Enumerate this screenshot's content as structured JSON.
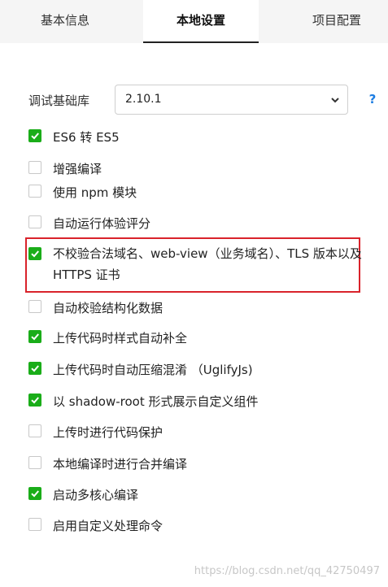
{
  "tabs": [
    {
      "label": "基本信息"
    },
    {
      "label": "本地设置"
    },
    {
      "label": "项目配置"
    }
  ],
  "lib": {
    "label": "调试基础库",
    "value": "2.10.1",
    "help": "?"
  },
  "options": [
    {
      "label": "ES6 转 ES5",
      "checked": true
    },
    {
      "label": "增强编译",
      "checked": false
    },
    {
      "label": "使用 npm 模块",
      "checked": false
    },
    {
      "label": "自动运行体验评分",
      "checked": false
    },
    {
      "label": "不校验合法域名、web-view（业务域名）、TLS 版本以及 HTTPS 证书",
      "checked": true
    },
    {
      "label": "自动校验结构化数据",
      "checked": false
    },
    {
      "label": "上传代码时样式自动补全",
      "checked": true
    },
    {
      "label": "上传代码时自动压缩混淆 （UglifyJs)",
      "checked": true
    },
    {
      "label": "以 shadow-root 形式展示自定义组件",
      "checked": true
    },
    {
      "label": "上传时进行代码保护",
      "checked": false
    },
    {
      "label": "本地编译时进行合并编译",
      "checked": false
    },
    {
      "label": "启动多核心编译",
      "checked": true
    },
    {
      "label": "启用自定义处理命令",
      "checked": false
    }
  ],
  "watermark": "https://blog.csdn.net/qq_42750497",
  "colors": {
    "check": "#1aad19",
    "highlight": "#d9232b",
    "help": "#1c7de2"
  }
}
